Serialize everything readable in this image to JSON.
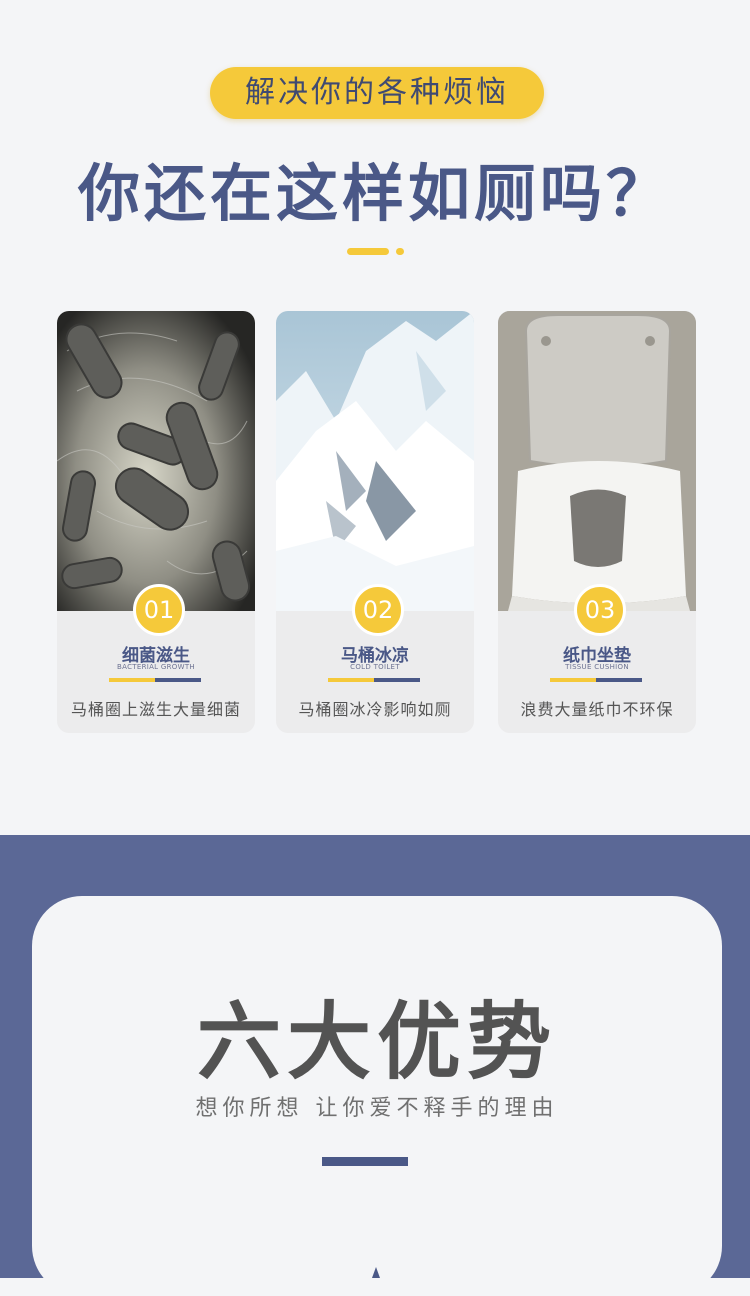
{
  "header": {
    "badge": "解决你的各种烦恼",
    "headline": "你还在这样如厕吗？"
  },
  "cards": [
    {
      "number": "01",
      "title": "细菌滋生",
      "subtitle": "BACTERIAL GROWTH",
      "description": "马桶圈上滋生大量细菌"
    },
    {
      "number": "02",
      "title": "马桶冰凉",
      "subtitle": "COLD TOILET",
      "description": "马桶圈冰冷影响如厕"
    },
    {
      "number": "03",
      "title": "纸巾坐垫",
      "subtitle": "TISSUE CUSHION",
      "description": "浪费大量纸巾不环保"
    }
  ],
  "advantages": {
    "title": "六大优势",
    "tagline": "想你所想 让你爱不释手的理由"
  },
  "colors": {
    "accent_yellow": "#f5c93a",
    "navy": "#4a5887",
    "band_blue": "#5b6896"
  }
}
